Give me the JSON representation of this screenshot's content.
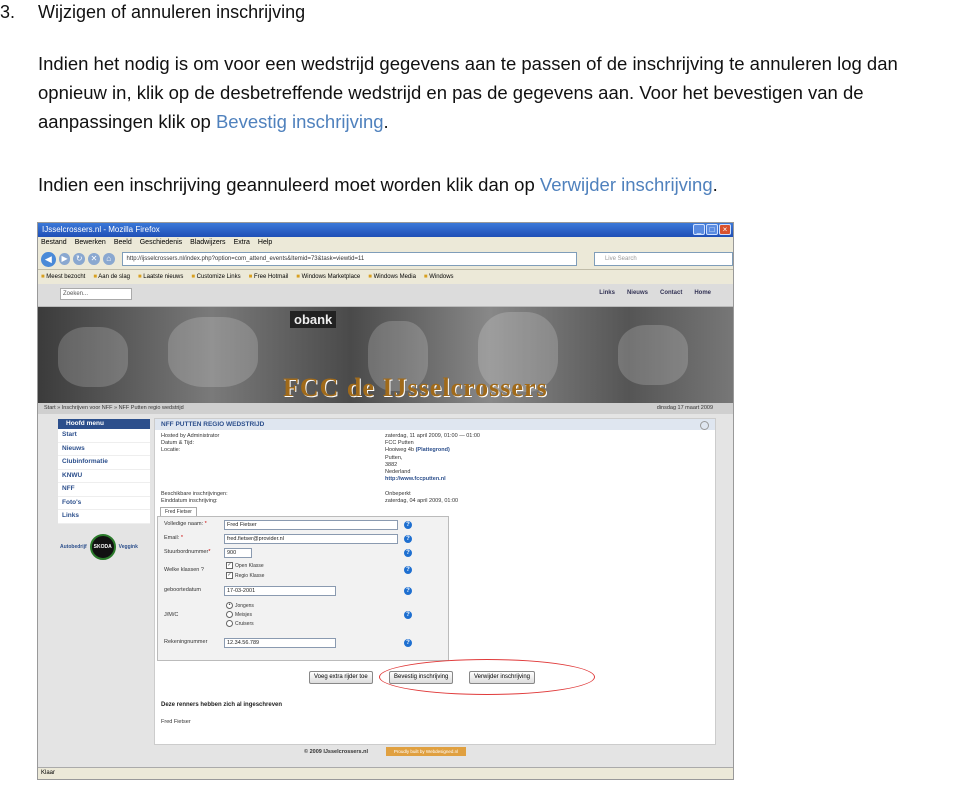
{
  "doc": {
    "section_number": "3.",
    "section_title": "Wijzigen of annuleren inschrijving",
    "para1": {
      "text1": "Indien het nodig is om voor een wedstrijd gegevens aan te passen of de inschrijving te annuleren log dan opnieuw in, klik op de desbetreffende wedstrijd en pas de gegevens aan. Voor het bevestigen van de aanpassingen klik op ",
      "link": "Bevestig inschrijving",
      "text2": "."
    },
    "para2": {
      "text1": "Indien een inschrijving geannuleerd moet worden klik dan op ",
      "link": "Verwijder inschrijving",
      "text2": "."
    },
    "link_color": "#4f81bd"
  },
  "browser": {
    "title": "IJsselcrossers.nl - Mozilla Firefox",
    "menu": [
      "Bestand",
      "Bewerken",
      "Beeld",
      "Geschiedenis",
      "Bladwijzers",
      "Extra",
      "Help"
    ],
    "url": "http://ijsselcrossers.nl/index.php?option=com_attend_events&Itemid=73&task=viewtid=11",
    "search_placeholder": "Live Search",
    "bookmarks": [
      "Meest bezocht",
      "Aan de slag",
      "Laatste nieuws",
      "Customize Links",
      "Free Hotmail",
      "Windows Marketplace",
      "Windows Media",
      "Windows"
    ],
    "status": "Klaar"
  },
  "site": {
    "search_placeholder": "Zoeken...",
    "topnav": [
      "Links",
      "Nieuws",
      "Contact",
      "Home"
    ],
    "banner_text": "FCC de IJsselcrossers",
    "banner_sign": "obank",
    "breadcrumb": "Start » Inschrijven voor NFF » NFF Putten regio wedstrijd",
    "date": "dinsdag 17 maart 2009",
    "menu_header": "Hoofd menu",
    "menu": [
      "Start",
      "Nieuws",
      "Clubinformatie",
      "KNWU",
      "NFF",
      "Foto's",
      "Links"
    ],
    "sponsor_left": "Autobedrijf",
    "sponsor_right": "Veggink",
    "sponsor_logo": "SKODA",
    "event_title": "NFF PUTTEN REGIO WEDSTRIJD",
    "info_labels": [
      "Hosted by Administrator",
      "Datum & Tijd:",
      "Locatie:"
    ],
    "info_values": [
      "zaterdag, 11 april 2009, 01:00 — 01:00",
      "FCC Putten",
      "Hooiweg 4b",
      "(Plattegrond)",
      "Putten,",
      "3882",
      "Nederland",
      "http://www.fccputten.nl"
    ],
    "avail_labels": [
      "Beschikbare inschrijvingen:",
      "Einddatum inschrijving:"
    ],
    "avail_values": [
      "Onbeperkt",
      "zaterdag, 04 april 2009, 01:00"
    ],
    "tab_label": "Fred Fietser",
    "form": {
      "naam_label": "Volledige naam:",
      "naam_value": "Fred Fietser",
      "email_label": "Email:",
      "email_value": "fred.fietser@provider.nl",
      "stuur_label": "Stuurbordnummer",
      "stuur_value": "900",
      "klassen_label": "Welke klassen ?",
      "klassen": [
        "Open Klasse",
        "Regio Klasse"
      ],
      "geboorte_label": "geboortedatum",
      "geboorte_value": "17-03-2001",
      "jmc_label": "J/M/C",
      "jmc_options": [
        "Jongens",
        "Meisjes",
        "Cruisers"
      ],
      "rekening_label": "Rekeningnummer",
      "rekening_value": "12.34.56.789"
    },
    "buttons": [
      "Voeg extra rijder toe",
      "Bevestig inschrijving",
      "Verwijder inschrijving"
    ],
    "renners_title": "Deze renners hebben zich al ingeschreven",
    "renner": "Fred Fietser",
    "copyright": "© 2009 IJsselcrossers.nl",
    "made_by": "Proudly built by Webdesigned.nl",
    "highlight_color": "#e03a3a"
  }
}
